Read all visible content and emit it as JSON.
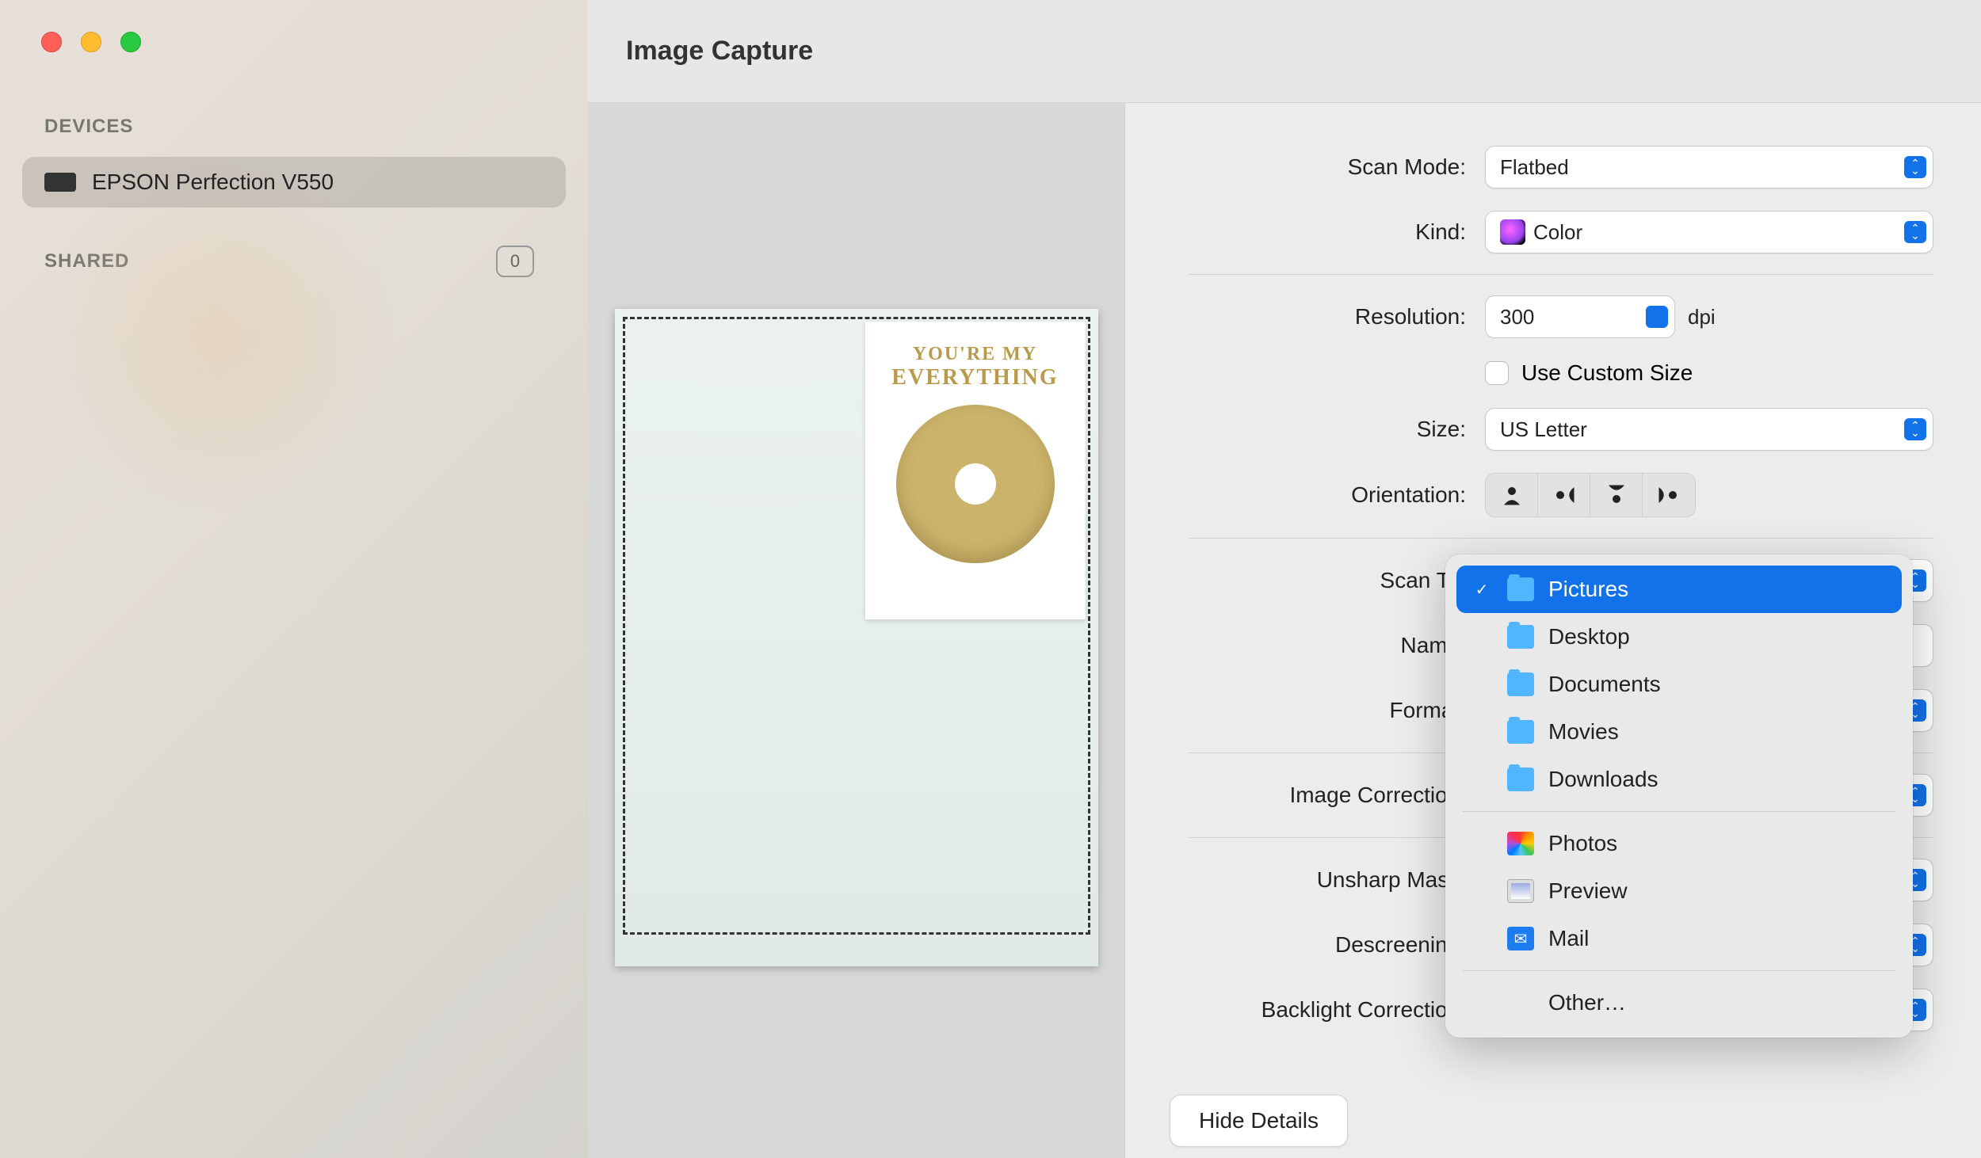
{
  "app_title": "Image Capture",
  "sidebar": {
    "devices_header": "DEVICES",
    "device_name": "EPSON Perfection V550",
    "shared_header": "SHARED",
    "shared_count": "0"
  },
  "preview": {
    "card_line1": "YOU'RE MY",
    "card_line2": "EVERYTHING"
  },
  "settings": {
    "scan_mode_label": "Scan Mode:",
    "scan_mode_value": "Flatbed",
    "kind_label": "Kind:",
    "kind_value": "Color",
    "resolution_label": "Resolution:",
    "resolution_value": "300",
    "resolution_unit": "dpi",
    "use_custom_size_label": "Use Custom Size",
    "size_label": "Size:",
    "size_value": "US Letter",
    "orientation_label": "Orientation:",
    "scan_to_label": "Scan To:",
    "name_label": "Name:",
    "format_label": "Format:",
    "image_correction_label": "Image Correction:",
    "unsharp_mask_label": "Unsharp Mask:",
    "descreening_label": "Descreening:",
    "backlight_correction_label": "Backlight Correction:"
  },
  "bottom": {
    "hide_details_label": "Hide Details"
  },
  "popover": {
    "items": [
      {
        "label": "Pictures",
        "selected": true,
        "type": "folder"
      },
      {
        "label": "Desktop",
        "selected": false,
        "type": "folder"
      },
      {
        "label": "Documents",
        "selected": false,
        "type": "folder"
      },
      {
        "label": "Movies",
        "selected": false,
        "type": "folder"
      },
      {
        "label": "Downloads",
        "selected": false,
        "type": "folder"
      }
    ],
    "apps": [
      {
        "label": "Photos",
        "type": "photos"
      },
      {
        "label": "Preview",
        "type": "preview"
      },
      {
        "label": "Mail",
        "type": "mail"
      }
    ],
    "other_label": "Other…"
  }
}
